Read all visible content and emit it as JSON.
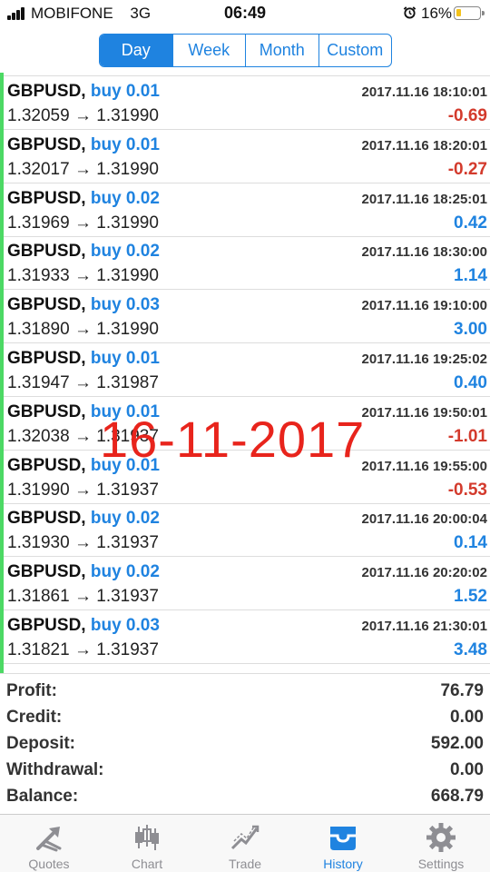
{
  "status_bar": {
    "carrier": "MOBIFONE",
    "network": "3G",
    "time": "06:49",
    "battery": "16%"
  },
  "period_tabs": [
    {
      "label": "Day",
      "active": true
    },
    {
      "label": "Week",
      "active": false
    },
    {
      "label": "Month",
      "active": false
    },
    {
      "label": "Custom",
      "active": false
    }
  ],
  "trades": [
    {
      "symbol": "GBPUSD,",
      "side": "buy 0.01",
      "open": "1.32059",
      "close": "1.31990",
      "time": "2017.11.16 18:10:01",
      "profit": "-0.69"
    },
    {
      "symbol": "GBPUSD,",
      "side": "buy 0.01",
      "open": "1.32017",
      "close": "1.31990",
      "time": "2017.11.16 18:20:01",
      "profit": "-0.27"
    },
    {
      "symbol": "GBPUSD,",
      "side": "buy 0.02",
      "open": "1.31969",
      "close": "1.31990",
      "time": "2017.11.16 18:25:01",
      "profit": "0.42"
    },
    {
      "symbol": "GBPUSD,",
      "side": "buy 0.02",
      "open": "1.31933",
      "close": "1.31990",
      "time": "2017.11.16 18:30:00",
      "profit": "1.14"
    },
    {
      "symbol": "GBPUSD,",
      "side": "buy 0.03",
      "open": "1.31890",
      "close": "1.31990",
      "time": "2017.11.16 19:10:00",
      "profit": "3.00"
    },
    {
      "symbol": "GBPUSD,",
      "side": "buy 0.01",
      "open": "1.31947",
      "close": "1.31987",
      "time": "2017.11.16 19:25:02",
      "profit": "0.40"
    },
    {
      "symbol": "GBPUSD,",
      "side": "buy 0.01",
      "open": "1.32038",
      "close": "1.31937",
      "time": "2017.11.16 19:50:01",
      "profit": "-1.01"
    },
    {
      "symbol": "GBPUSD,",
      "side": "buy 0.01",
      "open": "1.31990",
      "close": "1.31937",
      "time": "2017.11.16 19:55:00",
      "profit": "-0.53"
    },
    {
      "symbol": "GBPUSD,",
      "side": "buy 0.02",
      "open": "1.31930",
      "close": "1.31937",
      "time": "2017.11.16 20:00:04",
      "profit": "0.14"
    },
    {
      "symbol": "GBPUSD,",
      "side": "buy 0.02",
      "open": "1.31861",
      "close": "1.31937",
      "time": "2017.11.16 20:20:02",
      "profit": "1.52"
    },
    {
      "symbol": "GBPUSD,",
      "side": "buy 0.03",
      "open": "1.31821",
      "close": "1.31937",
      "time": "2017.11.16 21:30:01",
      "profit": "3.48"
    }
  ],
  "arrow": "→",
  "watermark": "16-11-2017",
  "summary": [
    {
      "label": "Profit:",
      "value": "76.79"
    },
    {
      "label": "Credit:",
      "value": "0.00"
    },
    {
      "label": "Deposit:",
      "value": "592.00"
    },
    {
      "label": "Withdrawal:",
      "value": "0.00"
    },
    {
      "label": "Balance:",
      "value": "668.79"
    }
  ],
  "tabbar": [
    {
      "label": "Quotes",
      "icon": "quotes-icon",
      "active": false
    },
    {
      "label": "Chart",
      "icon": "chart-icon",
      "active": false
    },
    {
      "label": "Trade",
      "icon": "trade-icon",
      "active": false
    },
    {
      "label": "History",
      "icon": "history-icon",
      "active": true
    },
    {
      "label": "Settings",
      "icon": "settings-icon",
      "active": false
    }
  ],
  "colors": {
    "accent": "#1f83e0",
    "loss": "#d33a2c",
    "row_marker": "#4cd964",
    "watermark": "#e8241c"
  }
}
